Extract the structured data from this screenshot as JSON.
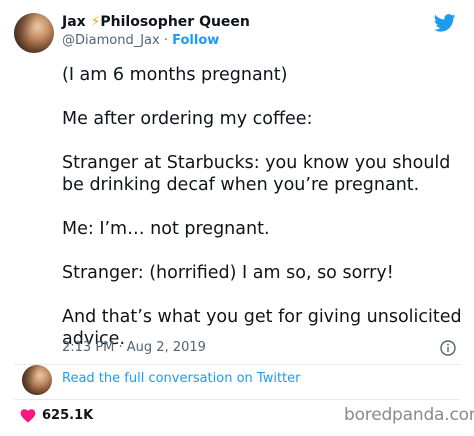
{
  "author": {
    "display_name_prefix": "Jax ",
    "display_name_emoji": "⚡",
    "display_name_suffix": "Philosopher Queen",
    "handle": "@Diamond_Jax",
    "separator": "·",
    "follow_label": "Follow"
  },
  "tweet": {
    "paragraphs": [
      "(I am 6 months pregnant)",
      "Me after ordering my coffee:",
      "Stranger at Starbucks: you know you should be drinking decaf when you’re pregnant.",
      "Me: I’m… not pregnant.",
      "Stranger: (horrified) I am so, so sorry!",
      "And that’s what you get for giving unsolicited advice."
    ],
    "timestamp": "2:13 PM · Aug 2, 2019"
  },
  "conversation": {
    "link_label": "Read the full conversation on Twitter"
  },
  "engagement": {
    "likes": "625.1K"
  },
  "watermark": {
    "text": "boredpanda.com"
  },
  "colors": {
    "twitter_blue": "#1d9bf0",
    "heart": "#f91880",
    "secondary_text": "#536471",
    "emoji_bolt": "#f5a623"
  },
  "icons": {
    "brand": "twitter-bird-icon",
    "info": "info-icon",
    "like": "heart-icon"
  }
}
